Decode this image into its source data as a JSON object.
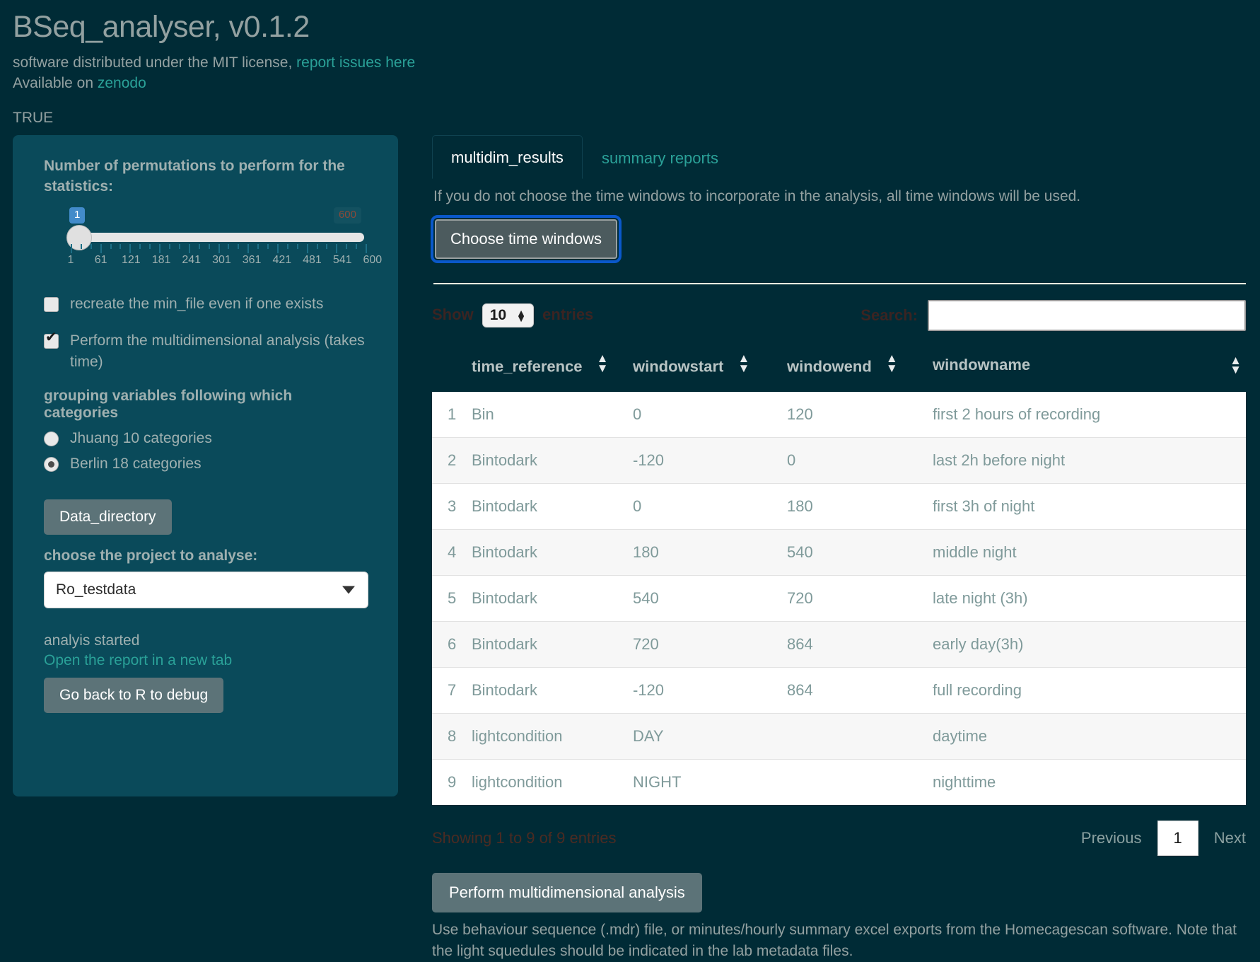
{
  "header": {
    "title": "BSeq_analyser, v0.1.2",
    "license_text": "software distributed under the MIT license, ",
    "issues_link": "report issues here",
    "available_prefix": "Available on ",
    "zenodo_link": "zenodo",
    "true_flag": "TRUE"
  },
  "sidebar": {
    "permutations_label": "Number of permutations to perform for the statistics:",
    "slider": {
      "value": "1",
      "max_label": "600",
      "ticks": [
        "1",
        "61",
        "121",
        "181",
        "241",
        "301",
        "361",
        "421",
        "481",
        "541",
        "600"
      ]
    },
    "checkboxes": [
      {
        "label": "recreate the min_file even if one exists",
        "checked": false
      },
      {
        "label": "Perform the multidimensional analysis (takes time)",
        "checked": true
      }
    ],
    "grouping_label": "grouping variables following which categories",
    "radios": [
      {
        "label": "Jhuang 10 categories",
        "selected": false
      },
      {
        "label": "Berlin 18 categories",
        "selected": true
      }
    ],
    "data_directory_button": "Data_directory",
    "project_label": "choose the project to analyse:",
    "project_value": "Ro_testdata",
    "analysis_status": "analyis started",
    "report_link": "Open the report in a new tab",
    "debug_button": "Go back to R to debug"
  },
  "main": {
    "tabs": [
      {
        "label": "multidim_results",
        "active": true
      },
      {
        "label": "summary reports",
        "active": false
      }
    ],
    "hint": "If you do not choose the time windows to incorporate in the analysis, all time windows will be used.",
    "choose_windows_button": "Choose time windows",
    "table_controls": {
      "show_label": "Show",
      "entries_label": "entries",
      "page_length": "10",
      "search_label": "Search:",
      "search_value": "",
      "search_placeholder": ""
    },
    "table": {
      "columns": [
        "",
        "time_reference",
        "windowstart",
        "windowend",
        "windowname"
      ],
      "rows": [
        [
          "1",
          "Bin",
          "0",
          "120",
          "first 2 hours of recording"
        ],
        [
          "2",
          "Bintodark",
          "-120",
          "0",
          "last 2h before night"
        ],
        [
          "3",
          "Bintodark",
          "0",
          "180",
          "first 3h of night"
        ],
        [
          "4",
          "Bintodark",
          "180",
          "540",
          "middle night"
        ],
        [
          "5",
          "Bintodark",
          "540",
          "720",
          "late night (3h)"
        ],
        [
          "6",
          "Bintodark",
          "720",
          "864",
          "early day(3h)"
        ],
        [
          "7",
          "Bintodark",
          "-120",
          "864",
          "full recording"
        ],
        [
          "8",
          "lightcondition",
          "DAY",
          "",
          "daytime"
        ],
        [
          "9",
          "lightcondition",
          "NIGHT",
          "",
          "nighttime"
        ]
      ]
    },
    "showing_info": "Showing 1 to 9 of 9 entries",
    "pagination": {
      "previous": "Previous",
      "current": "1",
      "next": "Next"
    },
    "perform_button": "Perform multidimensional analysis",
    "footer_note": "Use behaviour sequence (.mdr) file, or minutes/hourly summary excel exports from the Homecagescan software. Note that the light squedules should be indicated in the lab metadata files."
  },
  "colors": {
    "background": "#002b36",
    "sidebar": "#0a4a5a",
    "accent_link": "#2aa198",
    "focus_outline": "#0a58ca",
    "button_grey": "#5c7378"
  }
}
